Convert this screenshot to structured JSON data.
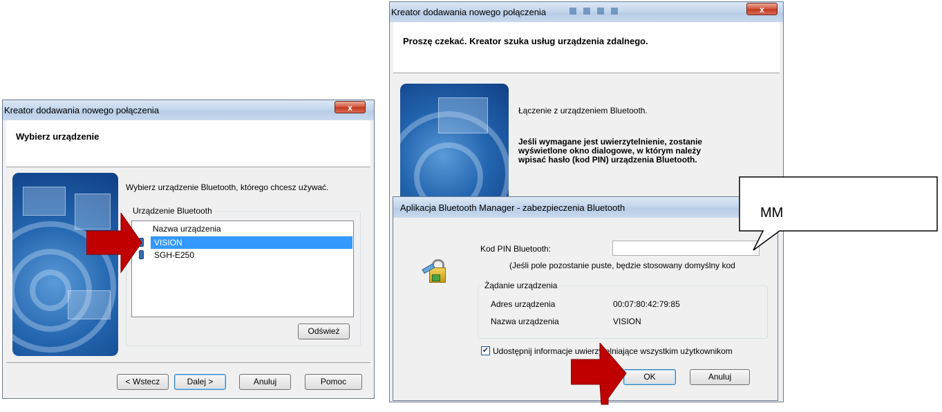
{
  "left_dialog": {
    "title": "Kreator dodawania nowego połączenia",
    "close": "x",
    "heading": "Wybierz urządzenie",
    "instruction": "Wybierz urządzenie Bluetooth, którego chcesz używać.",
    "group_label": "Urządzenie Bluetooth",
    "column_header": "Nazwa urządzenia",
    "devices": [
      {
        "name": "VISION",
        "selected": true,
        "icon": "phone-icon"
      },
      {
        "name": "SGH-E250",
        "selected": false,
        "icon": "phone-icon"
      }
    ],
    "refresh_button": "Odśwież",
    "buttons": {
      "back": "< Wstecz",
      "next": "Dalej >",
      "cancel": "Anuluj",
      "help": "Pomoc"
    }
  },
  "right_dialog": {
    "title": "Kreator dodawania nowego połączenia",
    "close": "x",
    "heading": "Proszę czekać. Kreator szuka usług urządzenia zdalnego.",
    "connecting": "Łączenie z urządzeniem Bluetooth.",
    "auth_note": [
      "Jeśli wymagane jest uwierzytelnienie, zostanie",
      "wyświetlone okno dialogowe, w którym należy",
      "wpisać hasło (kod PIN) urządzenia Bluetooth."
    ]
  },
  "security_dialog": {
    "title": "Aplikacja Bluetooth Manager - zabezpieczenia Bluetooth",
    "pin_label": "Kod PIN Bluetooth:",
    "pin_value": "",
    "pin_hint": "(Jeśli pole pozostanie puste, będzie stosowany domyślny kod",
    "group_label": "Żądanie urządzenia",
    "address_label": "Adres urządzenia",
    "address_value": "00:07:80:42:79:85",
    "name_label": "Nazwa urządzenia",
    "name_value": "VISION",
    "share_checkbox": "Udostępnij informacje uwierzytelniające wszystkim użytkownikom",
    "share_checked": true,
    "ok_button": "OK",
    "cancel_button": "Anuluj"
  },
  "callout": {
    "text": "MM"
  },
  "colors": {
    "arrow": "#c00000",
    "selection": "#3399ff"
  }
}
